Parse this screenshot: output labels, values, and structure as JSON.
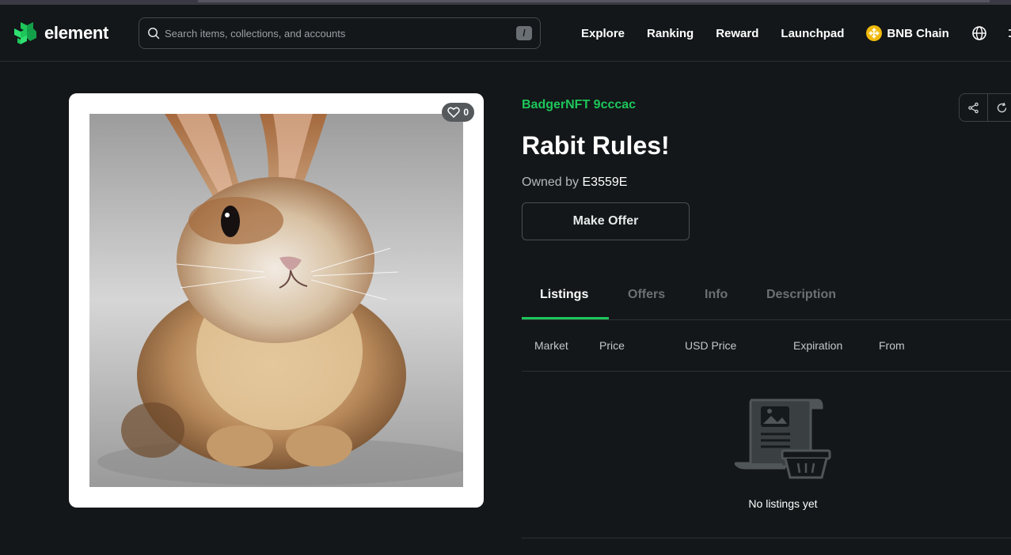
{
  "header": {
    "brand": "element",
    "search": {
      "placeholder": "Search items, collections, and accounts",
      "shortcut": "/"
    },
    "nav": [
      "Explore",
      "Ranking",
      "Reward",
      "Launchpad"
    ],
    "chain": "BNB Chain"
  },
  "nft": {
    "likes": "0",
    "collection": "BadgerNFT 9cccac",
    "title": "Rabit Rules!",
    "owned_by_label": "Owned by",
    "owner": "E3559E",
    "make_offer": "Make Offer"
  },
  "tabs": [
    "Listings",
    "Offers",
    "Info",
    "Description"
  ],
  "active_tab": "Listings",
  "listings": {
    "columns": [
      "Market",
      "Price",
      "USD Price",
      "Expiration",
      "From"
    ],
    "rows": [],
    "empty_text": "No listings yet"
  },
  "colors": {
    "accent": "#1ec65a",
    "background": "#131719",
    "bnb": "#f0b90b"
  }
}
